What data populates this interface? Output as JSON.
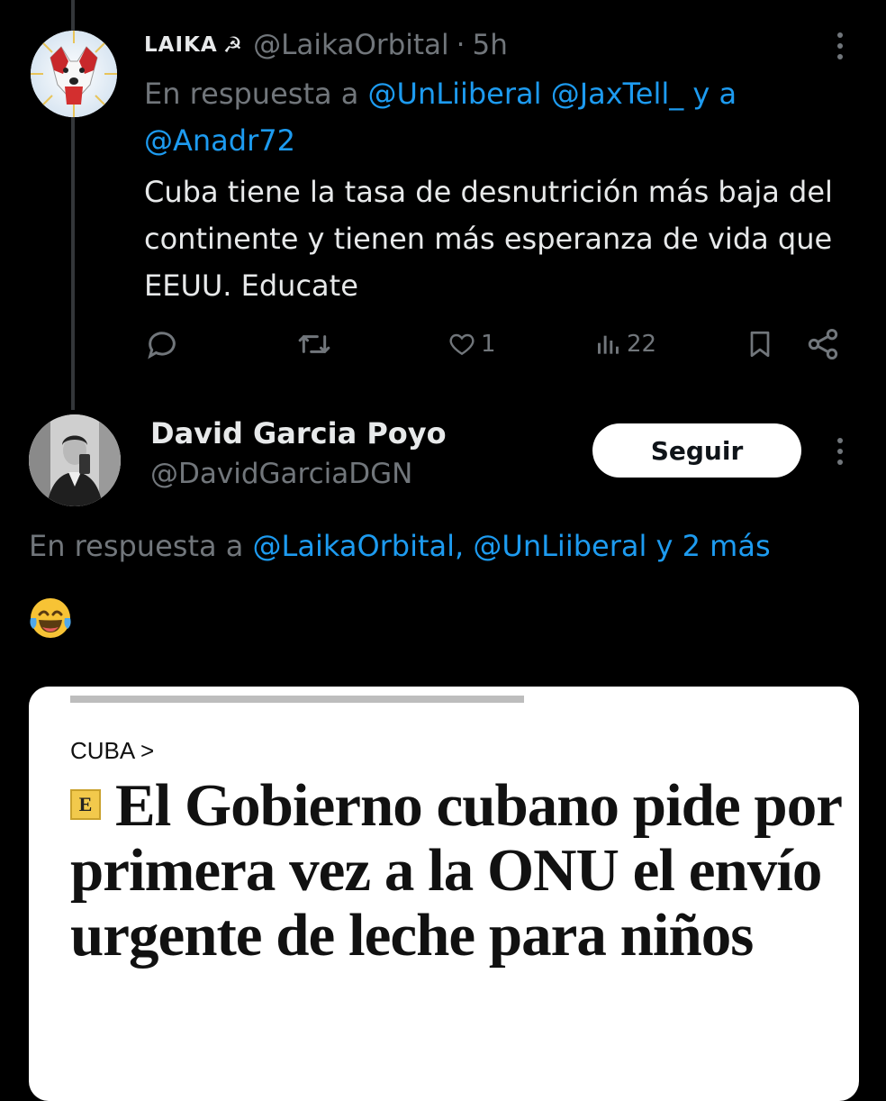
{
  "tweet1": {
    "display_name": "LAIKA",
    "name_symbol": "☭",
    "handle": "@LaikaOrbital",
    "separator": "·",
    "time": "5h",
    "reply_prefix": "En respuesta a",
    "reply_to_1": "@UnLiiberal",
    "reply_to_2": "@JaxTell_",
    "reply_and": "y a",
    "reply_to_3": "@Anadr72",
    "text": "Cuba tiene la tasa de desnutrición más baja del continente y tienen más esperanza de vida que EEUU. Educate",
    "likes": "1",
    "views": "22",
    "icons": [
      "reply-icon",
      "retweet-icon",
      "like-icon",
      "views-icon",
      "bookmark-icon",
      "share-icon",
      "more-icon"
    ]
  },
  "tweet2": {
    "display_name": "David Garcia Poyo",
    "handle": "@DavidGarciaDGN",
    "follow_label": "Seguir",
    "reply_prefix": "En respuesta a",
    "reply_to": "@LaikaOrbital, @UnLiiberal y 2 más",
    "emoji": "😂"
  },
  "article": {
    "kicker": "CUBA >",
    "badge_letter": "E",
    "headline": "El Gobierno cubano pide por primera vez a la ONU el envío urgente de leche para niños"
  },
  "colors": {
    "background": "#000000",
    "text": "#e7e9ea",
    "muted": "#71767b",
    "link": "#1d9bf0",
    "badge": "#f2c94c"
  }
}
